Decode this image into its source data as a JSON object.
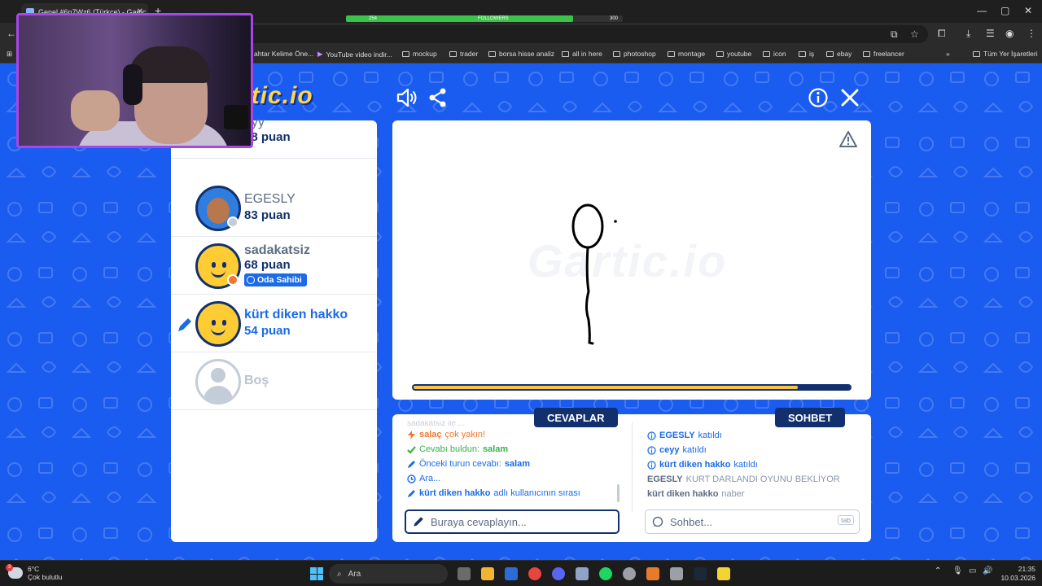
{
  "browser": {
    "tab_title": "Genel #6n7Wz6 (Türkçe) - Gartic",
    "followers_label": "FOLLOWERS",
    "followers_left": "254",
    "followers_right": "300",
    "followers_progress": 0.82,
    "bookmarks": [
      "ahtar Kelime Öne...",
      "YouTube video indir...",
      "mockup",
      "trader",
      "borsa hisse analiz",
      "all in here",
      "photoshop",
      "montage",
      "youtube",
      "icon",
      "iş",
      "ebay",
      "freelancer"
    ],
    "all_bookmarks": "Tüm Yer İşaretleri"
  },
  "game": {
    "logo": "rtic.io",
    "watermark": "Gartic.io",
    "players": [
      {
        "name": "eyy",
        "points": "98 puan",
        "status_color": "#ffcc33"
      },
      {
        "name": "EGESLY",
        "points": "83 puan",
        "status_color": "#c3ccd9"
      },
      {
        "name": "sadakatsiz",
        "points": "68 puan",
        "badge": "Oda Sahibi",
        "status_color": "#f2762e"
      },
      {
        "name": "kürt diken hakko",
        "points": "54 puan"
      }
    ],
    "empty_slot": "Boş",
    "timer_progress": 0.88,
    "answers_title": "CEVAPLAR",
    "chat_title": "SOHBET",
    "answers": [
      {
        "icon": "lightning-icon",
        "user": "salaç",
        "text": "çok yakın!"
      },
      {
        "icon": "check-icon",
        "text": "Cevabı buldun:",
        "value": "salam"
      },
      {
        "icon": "pencil-icon",
        "text": "Önceki turun cevabı:",
        "value": "salam"
      },
      {
        "icon": "clock-icon",
        "text": "Ara..."
      },
      {
        "icon": "pencil-icon",
        "user": "kürt diken hakko",
        "text": "adlı kullanıcının sırası"
      }
    ],
    "chat": [
      {
        "icon": "info-icon",
        "user": "EGESLY",
        "text": "katıldı"
      },
      {
        "icon": "info-icon",
        "user": "ceyy",
        "text": "katıldı"
      },
      {
        "icon": "info-icon",
        "user": "kürt diken hakko",
        "text": "katıldı"
      },
      {
        "user": "EGESLY",
        "text": "KURT DARLANDI OYUNU BEKLİYOR"
      },
      {
        "user": "kürt diken hakko",
        "text": "naber"
      }
    ],
    "answer_placeholder": "Buraya cevaplayın...",
    "chat_placeholder": "Sohbet...",
    "tab_hint": "tab"
  },
  "taskbar": {
    "temperature": "6°C",
    "weather": "Çok bulutlu",
    "weather_badge": "3",
    "search": "Ara",
    "time": "21:35",
    "date": "10.03.2026"
  },
  "colors": {
    "background": "#1a5cf0",
    "navy": "#13306e",
    "accent_blue": "#1a6be8",
    "timer_yellow": "#f7c542",
    "webcam_border": "#a846e8"
  }
}
